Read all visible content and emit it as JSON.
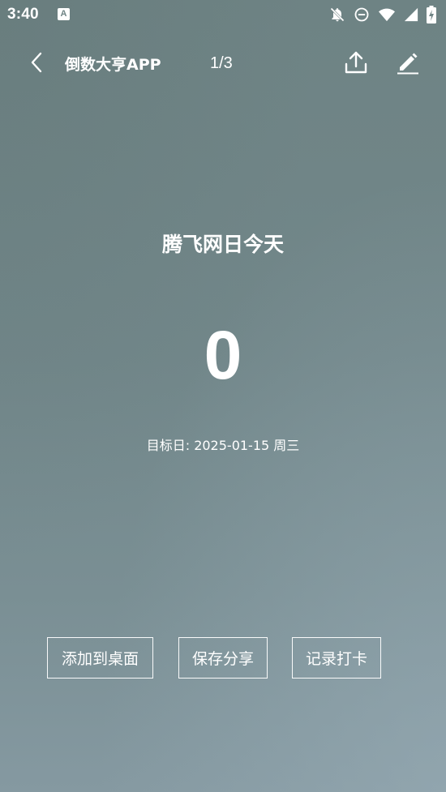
{
  "status_bar": {
    "time": "3:40",
    "app_badge": "A",
    "icons": [
      "bell-off-icon",
      "do-not-disturb-icon",
      "wifi-icon",
      "signal-icon",
      "battery-charging-icon"
    ]
  },
  "top_bar": {
    "title": "倒数大亨APP",
    "page_indicator": "1/3",
    "icons": [
      "back-arrow-icon",
      "share-upload-icon",
      "edit-pencil-icon"
    ]
  },
  "main": {
    "event_title": "腾飞网日今天",
    "countdown": "0",
    "target_date": "目标日: 2025-01-15 周三"
  },
  "actions": {
    "add_to_desktop": "添加到桌面",
    "save_share": "保存分享",
    "check_in": "记录打卡"
  },
  "colors": {
    "background": "#73888a",
    "text": "#ffffff"
  }
}
